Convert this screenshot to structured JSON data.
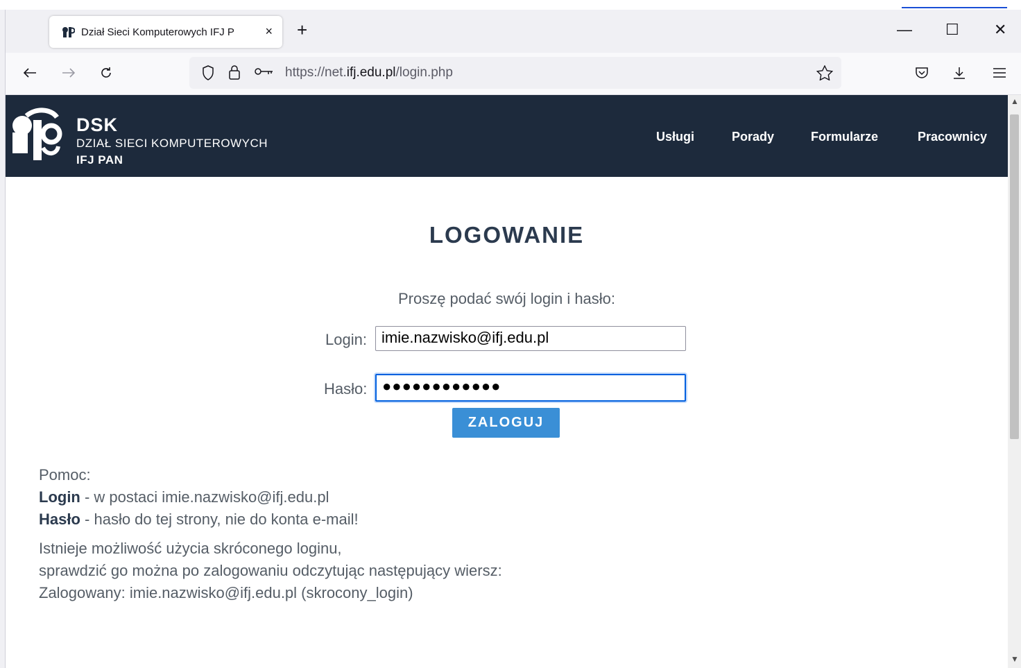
{
  "browser": {
    "tab_title": "Dział Sieci Komputerowych IFJ P",
    "tab_close": "×",
    "new_tab": "+",
    "url_prefix": "https://net.",
    "url_domain": "ifj.edu.pl",
    "url_path": "/login.php",
    "window_controls": [
      "—",
      "☐",
      "✕"
    ]
  },
  "site": {
    "brand_title": "DSK",
    "brand_line1": "DZIAŁ SIECI KOMPUTEROWYCH",
    "brand_line2": "IFJ PAN",
    "nav": [
      "Usługi",
      "Porady",
      "Formularze",
      "Pracownicy"
    ]
  },
  "login": {
    "heading": "LOGOWANIE",
    "prompt": "Proszę podać swój login i hasło:",
    "login_label": "Login:",
    "login_value": "imie.nazwisko@ifj.edu.pl",
    "password_label": "Hasło:",
    "password_value": "●●●●●●●●●●●●",
    "submit": "ZALOGUJ"
  },
  "help": {
    "title": "Pomoc:",
    "login_term": "Login",
    "login_desc": " - w postaci imie.nazwisko@ifj.edu.pl",
    "password_term": "Hasło",
    "password_desc": " - hasło do tej strony, nie do konta e-mail!",
    "note_line1": "Istnieje możliwość użycia skróconego loginu,",
    "note_line2": "sprawdzić go można po zalogowaniu odczytując następujący wiersz:",
    "note_line3": "Zalogowany: imie.nazwisko@ifj.edu.pl (skrocony_login)"
  }
}
